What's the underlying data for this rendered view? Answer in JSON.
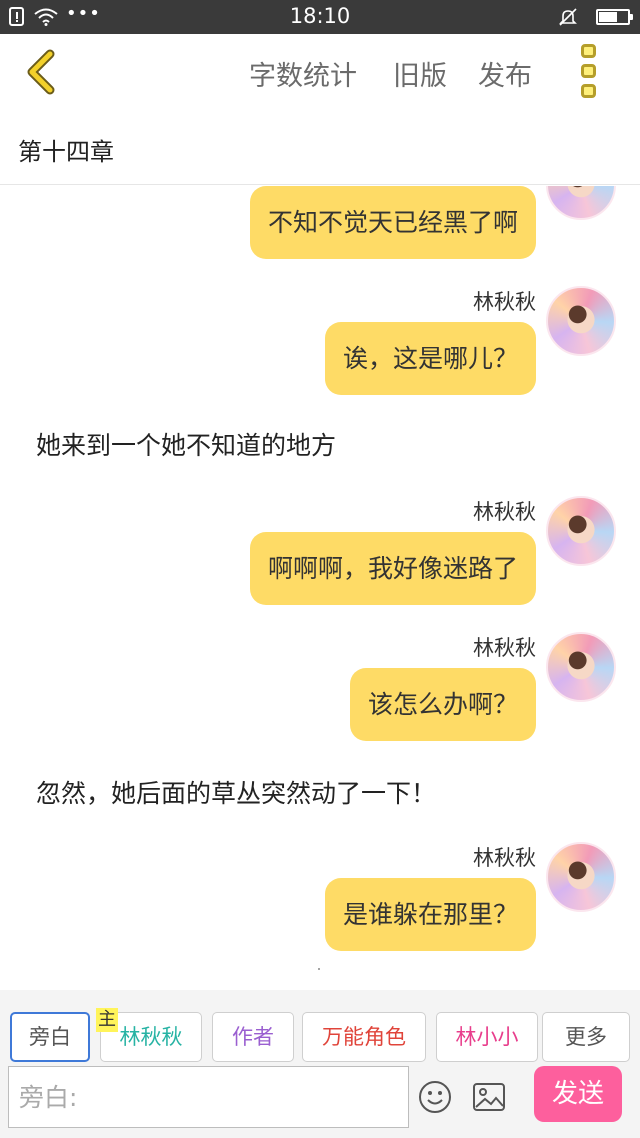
{
  "status_bar": {
    "time": "18:10",
    "battery_level": 0.6,
    "icons": [
      "sim-alert-icon",
      "wifi-icon",
      "more-dots-icon",
      "mute-bell-icon",
      "battery-icon"
    ],
    "dots": "•••"
  },
  "nav": {
    "word_count": "字数统计",
    "old_version": "旧版",
    "publish": "发布",
    "back_icon": "chevron-left-icon",
    "menu_icon": "kebab-menu-icon",
    "accent": "#f3d12a"
  },
  "chapter": {
    "title": "第十四章"
  },
  "messages": [
    {
      "type": "dialogue",
      "sender": "",
      "text": "不知不觉天已经黑了啊"
    },
    {
      "type": "dialogue",
      "sender": "林秋秋",
      "text": "诶，这是哪儿？"
    },
    {
      "type": "narration",
      "text": "她来到一个她不知道的地方"
    },
    {
      "type": "dialogue",
      "sender": "林秋秋",
      "text": "啊啊啊，我好像迷路了"
    },
    {
      "type": "dialogue",
      "sender": "林秋秋",
      "text": "该怎么办啊？"
    },
    {
      "type": "narration",
      "text": "忽然，她后面的草丛突然动了一下！"
    },
    {
      "type": "dialogue",
      "sender": "林秋秋",
      "text": "是谁躲在那里？"
    }
  ],
  "roles": [
    {
      "label": "旁白",
      "color": "#555555",
      "selected": true
    },
    {
      "label": "林秋秋",
      "color": "#27b3a4",
      "badge": "主"
    },
    {
      "label": "作者",
      "color": "#9a5fd0"
    },
    {
      "label": "万能角色",
      "color": "#e0443a"
    },
    {
      "label": "林小小",
      "color": "#e83e8c"
    },
    {
      "label": "更多",
      "color": "#555555"
    }
  ],
  "composer": {
    "placeholder": "旁白:",
    "send": "发送",
    "send_color": "#fd5f9d",
    "emoji_icon": "smiley-icon",
    "image_icon": "image-icon"
  },
  "bubble_color": "#fedb66"
}
